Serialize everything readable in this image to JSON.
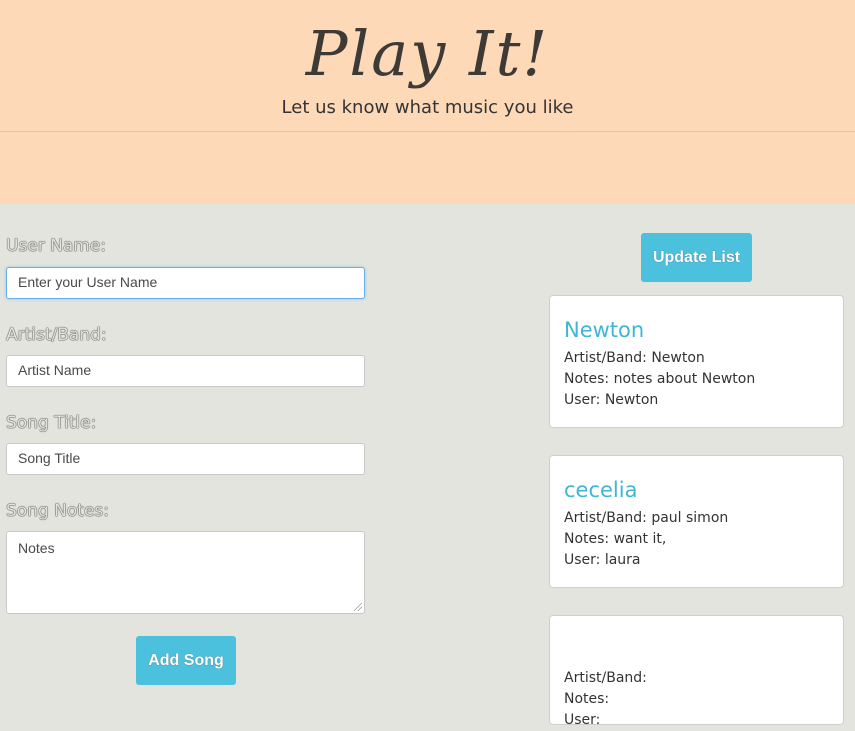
{
  "header": {
    "title": "Play It!",
    "subtitle": "Let us know what music you like"
  },
  "form": {
    "user_name_label": "User Name:",
    "user_name_placeholder": "Enter your User Name",
    "artist_label": "Artist/Band:",
    "artist_placeholder": "Artist Name",
    "song_title_label": "Song Title:",
    "song_title_placeholder": "Song Title",
    "notes_label": "Song Notes:",
    "notes_placeholder": "Notes",
    "add_button": "Add Song"
  },
  "list": {
    "update_button": "Update List",
    "cards": [
      {
        "title": "Newton",
        "artist": "Artist/Band: Newton",
        "notes": "Notes: notes about Newton",
        "user": "User: Newton"
      },
      {
        "title": "cecelia",
        "artist": "Artist/Band: paul simon",
        "notes": "Notes: want it,",
        "user": "User: laura"
      },
      {
        "title": "",
        "artist": "Artist/Band:",
        "notes": "Notes:",
        "user": "User:"
      }
    ]
  },
  "colors": {
    "header_bg": "#fed9b8",
    "page_bg": "#e4e4de",
    "accent": "#4cc1de",
    "card_title": "#3fb6d6"
  }
}
